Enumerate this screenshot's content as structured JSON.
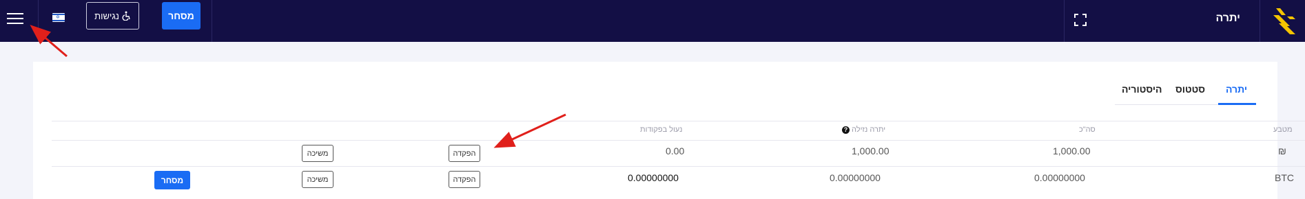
{
  "header": {
    "balance_label": "יתרה",
    "trade_button": "מסחר",
    "accessibility_button": "נגישות",
    "accessibility_icon": "wheelchair-icon",
    "logo_icon": "brand-logo",
    "fullscreen_icon": "fullscreen-icon",
    "flag_icon": "israel-flag-icon",
    "menu_icon": "hamburger-icon"
  },
  "tabs": [
    {
      "label": "יתרה",
      "active": true
    },
    {
      "label": "סטטוס",
      "active": false
    },
    {
      "label": "היסטוריה",
      "active": false
    }
  ],
  "table": {
    "columns": [
      "מטבע",
      "סה\"כ",
      "יתרה נזילה",
      "נעול בפקודות"
    ],
    "rows": [
      {
        "currency": "₪",
        "total": "1,000.00",
        "available": "1,000.00",
        "locked": "0.00",
        "deposit": "הפקדה",
        "withdraw": "משיכה",
        "trade": ""
      },
      {
        "currency": "BTC",
        "total": "0.00000000",
        "available": "0.00000000",
        "locked": "0.00000000",
        "deposit": "הפקדה",
        "withdraw": "משיכה",
        "trade": "מסחר"
      }
    ]
  },
  "colors": {
    "topbar": "#130f45",
    "accent": "#1a6cf4",
    "logo": "#f5c400",
    "annotation_arrow": "#e0201b"
  }
}
